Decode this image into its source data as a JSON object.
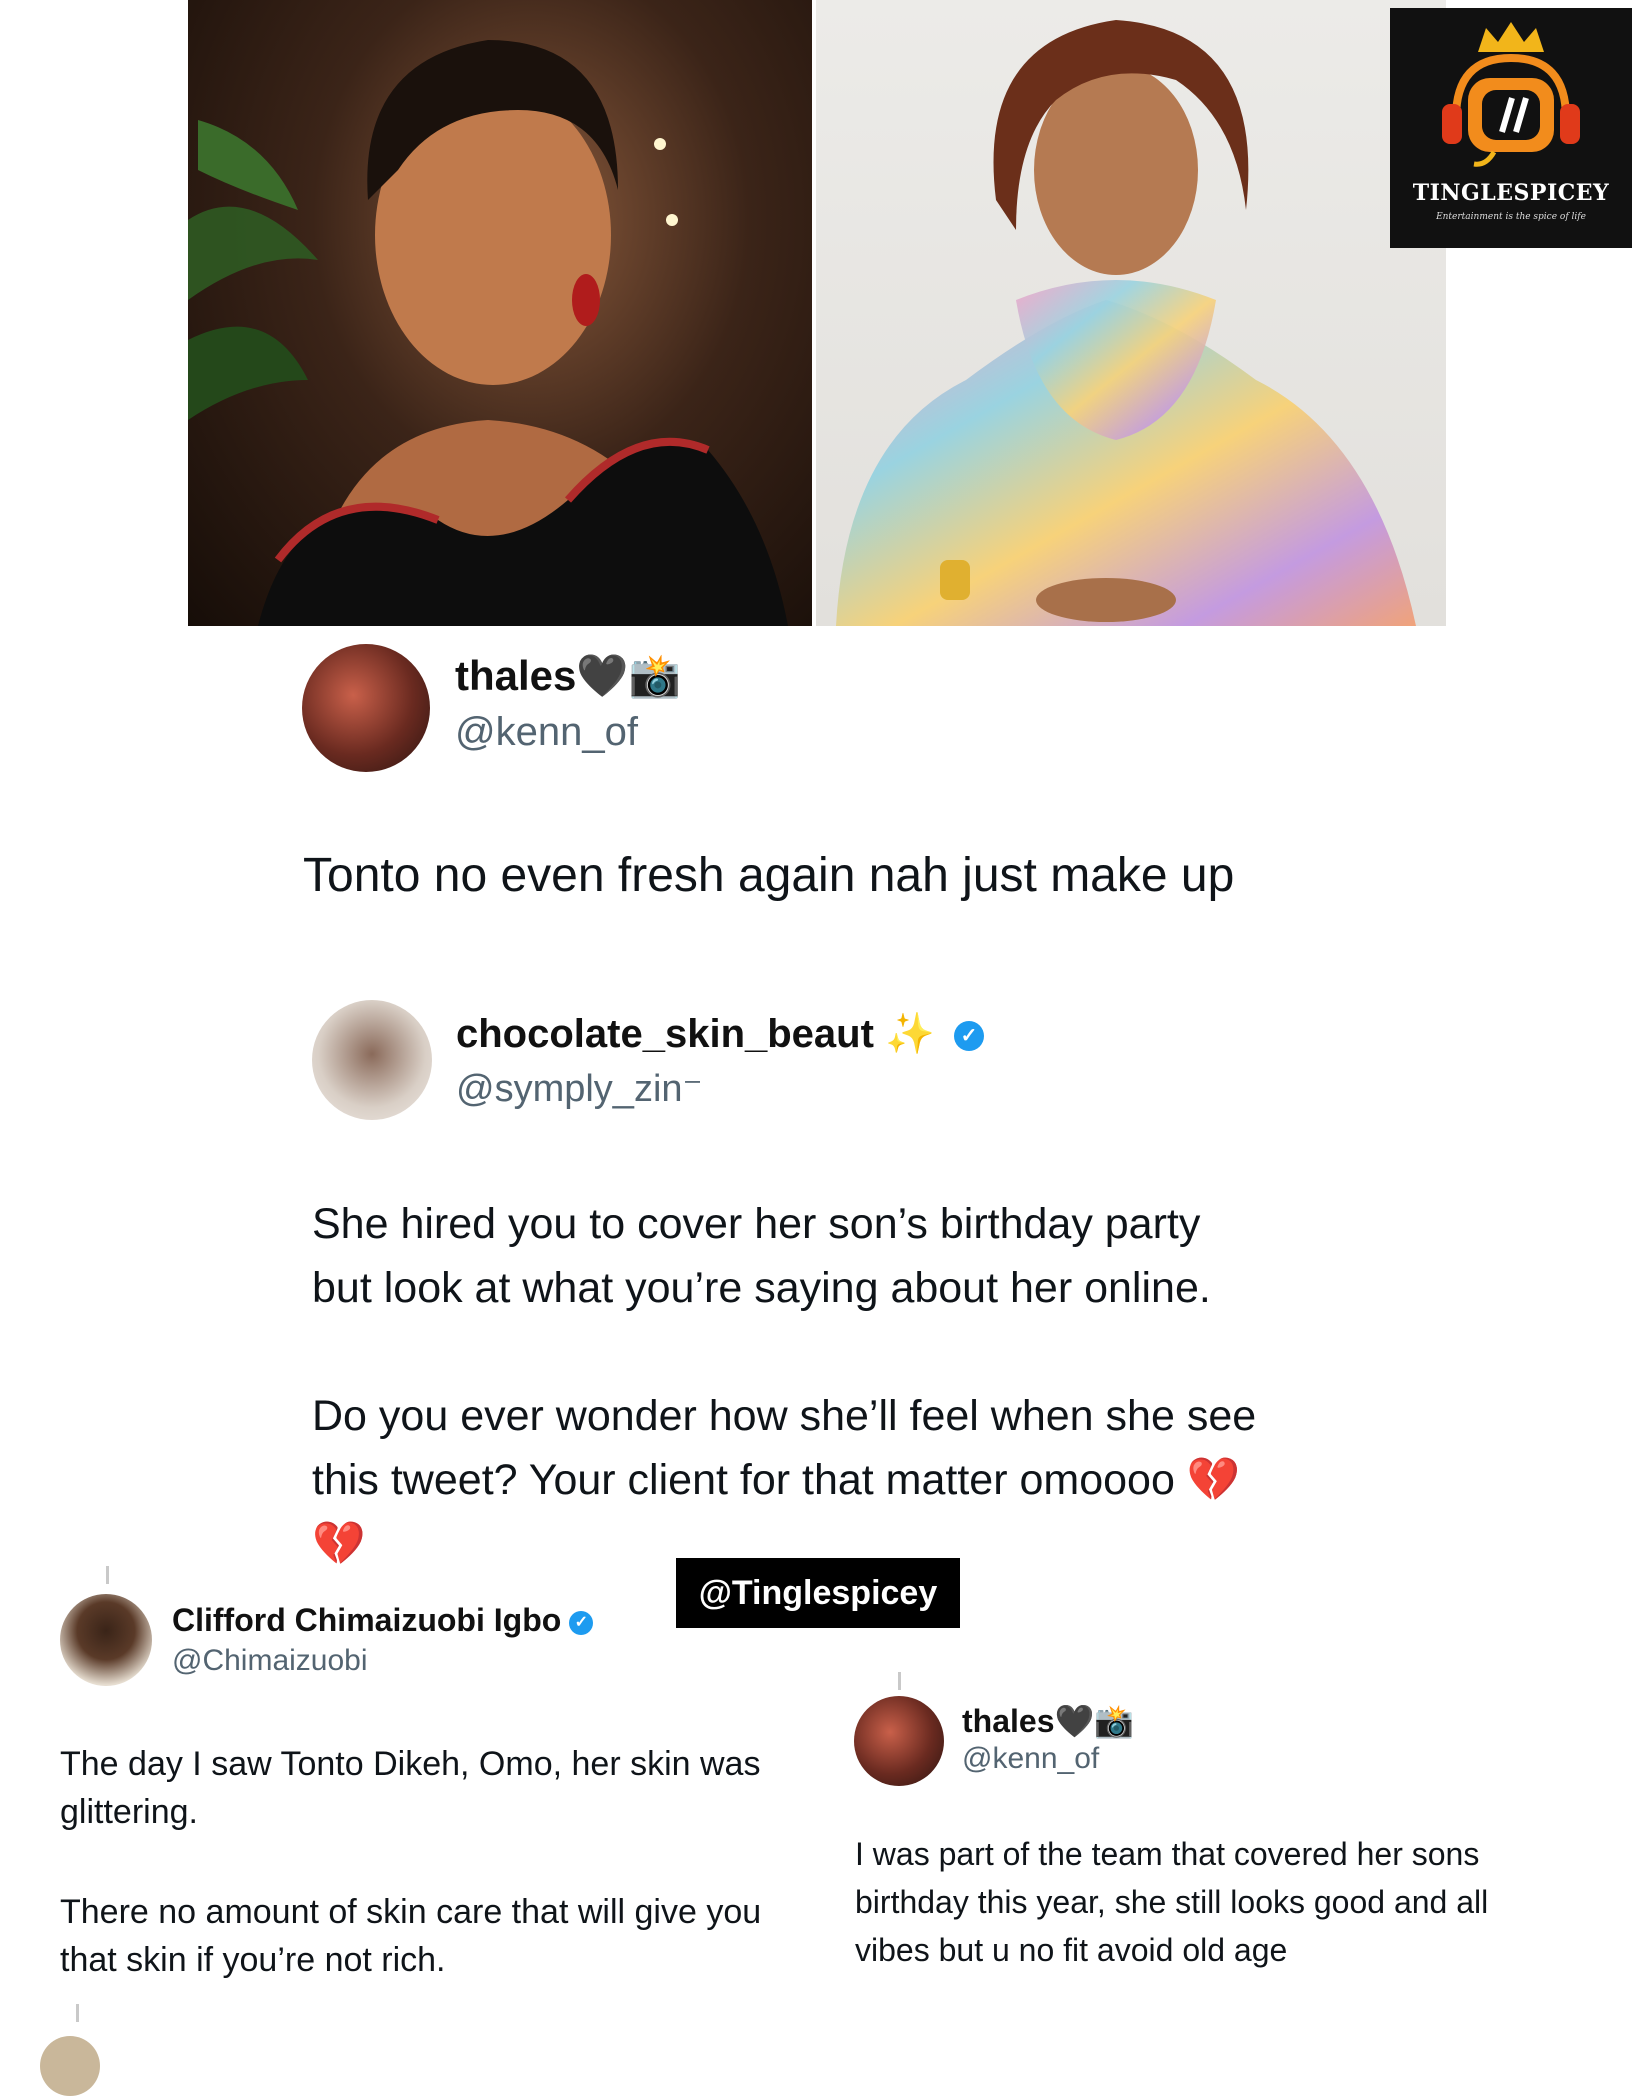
{
  "logo": {
    "title": "TINGLESPICEY",
    "tagline": "Entertainment is the spice of life"
  },
  "tweet1": {
    "name": "thales",
    "name_emojis": "🖤📸",
    "handle": "@kenn_of",
    "text": "Tonto no even fresh again nah just make up"
  },
  "tweet2": {
    "name": "chocolate_skin_beaut",
    "name_emojis": "✨",
    "handle": "@symply_zin⁻",
    "para1_line1": "She hired you to cover her son’s birthday party",
    "para1_line2": "but look at what you’re saying about her online.",
    "para2_line1": "Do you ever wonder how she’ll feel when she see",
    "para2_line2": "this tweet? Your client for that matter omoooo 💔",
    "para2_line3": "💔"
  },
  "watermark": "@Tinglespicey",
  "tweet3": {
    "name": "Clifford Chimaizuobi Igbo",
    "handle": "@Chimaizuobi",
    "para1_line1": "The day I saw Tonto Dikeh, Omo, her skin was",
    "para1_line2": "glittering.",
    "para2_line1": "There no amount of skin care that will give you",
    "para2_line2": "that skin if you’re not rich."
  },
  "tweet4": {
    "name": "thales",
    "name_emojis": "🖤📸",
    "handle": "@kenn_of",
    "line1": "I was part of the team that covered her sons",
    "line2": "birthday this year, she still looks good and all",
    "line3": "vibes but u no fit avoid old age"
  },
  "colors": {
    "verified": "#1d9bf0",
    "handle": "#536471",
    "logo_orange": "#f28c1c"
  }
}
